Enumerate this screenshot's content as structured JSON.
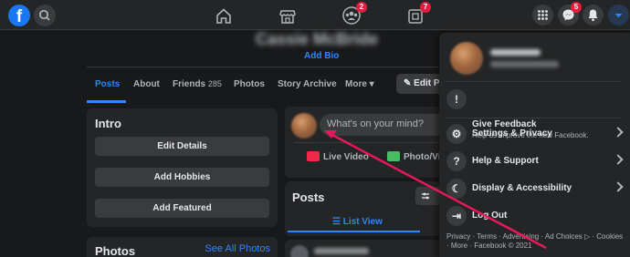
{
  "topbar": {
    "logo_letter": "f",
    "groups_badge": "2",
    "gaming_badge": "7",
    "messenger_badge": "5"
  },
  "profile": {
    "add_bio": "Add Bio"
  },
  "tabs": [
    {
      "label": "Posts"
    },
    {
      "label": "About"
    },
    {
      "label": "Friends",
      "count": "285"
    },
    {
      "label": "Photos"
    },
    {
      "label": "Story Archive"
    },
    {
      "label": "More ▾"
    }
  ],
  "edit_profile_label": "Edit Pr",
  "intro": {
    "title": "Intro",
    "buttons": [
      "Edit Details",
      "Add Hobbies",
      "Add Featured"
    ]
  },
  "photos_card": {
    "title": "Photos",
    "see_all": "See All Photos"
  },
  "composer": {
    "placeholder": "What's on your mind?",
    "live_video": "Live Video",
    "photo_video": "Photo/Vid"
  },
  "posts": {
    "title": "Posts",
    "list_view": "☰ List View"
  },
  "menu": {
    "feedback_label": "Give Feedback",
    "feedback_sub": "Help us improve the new Facebook.",
    "items": [
      {
        "label": "Settings & Privacy"
      },
      {
        "label": "Help & Support"
      },
      {
        "label": "Display & Accessibility"
      },
      {
        "label": "Log Out"
      }
    ],
    "footer": "Privacy · Terms · Advertising · Ad Choices ▷ · Cookies · More · Facebook © 2021"
  },
  "colors": {
    "accent": "#2d88ff",
    "badge": "#e41e3f",
    "annotation_arrow": "#e8185c"
  }
}
